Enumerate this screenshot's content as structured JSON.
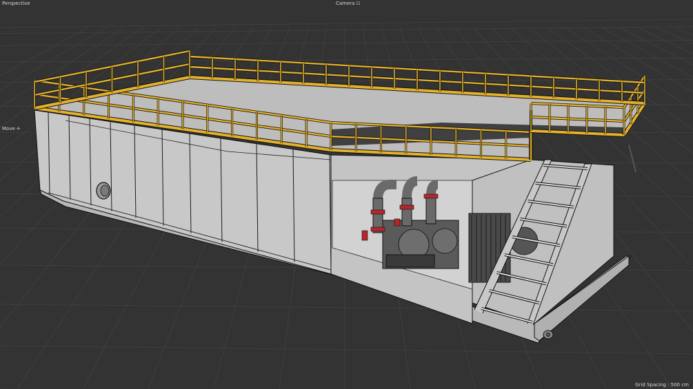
{
  "viewport": {
    "view_name": "Perspective",
    "camera_label": "Camera",
    "camera_icon": "camera-lock-icon",
    "tool_label": "Move",
    "tool_icon": "move-crosshair-icon",
    "grid_spacing_text": "Grid Spacing : 500 cm"
  },
  "colors": {
    "background": "#333333",
    "grid_line": "#3e3e3e",
    "tank_fill": "#c9c9c9",
    "tank_shadow": "#a8a8a8",
    "wireframe": "#111111",
    "railing": "#e3b12c",
    "pump_body": "#5a5a5a",
    "flange_red": "#c0272d"
  }
}
